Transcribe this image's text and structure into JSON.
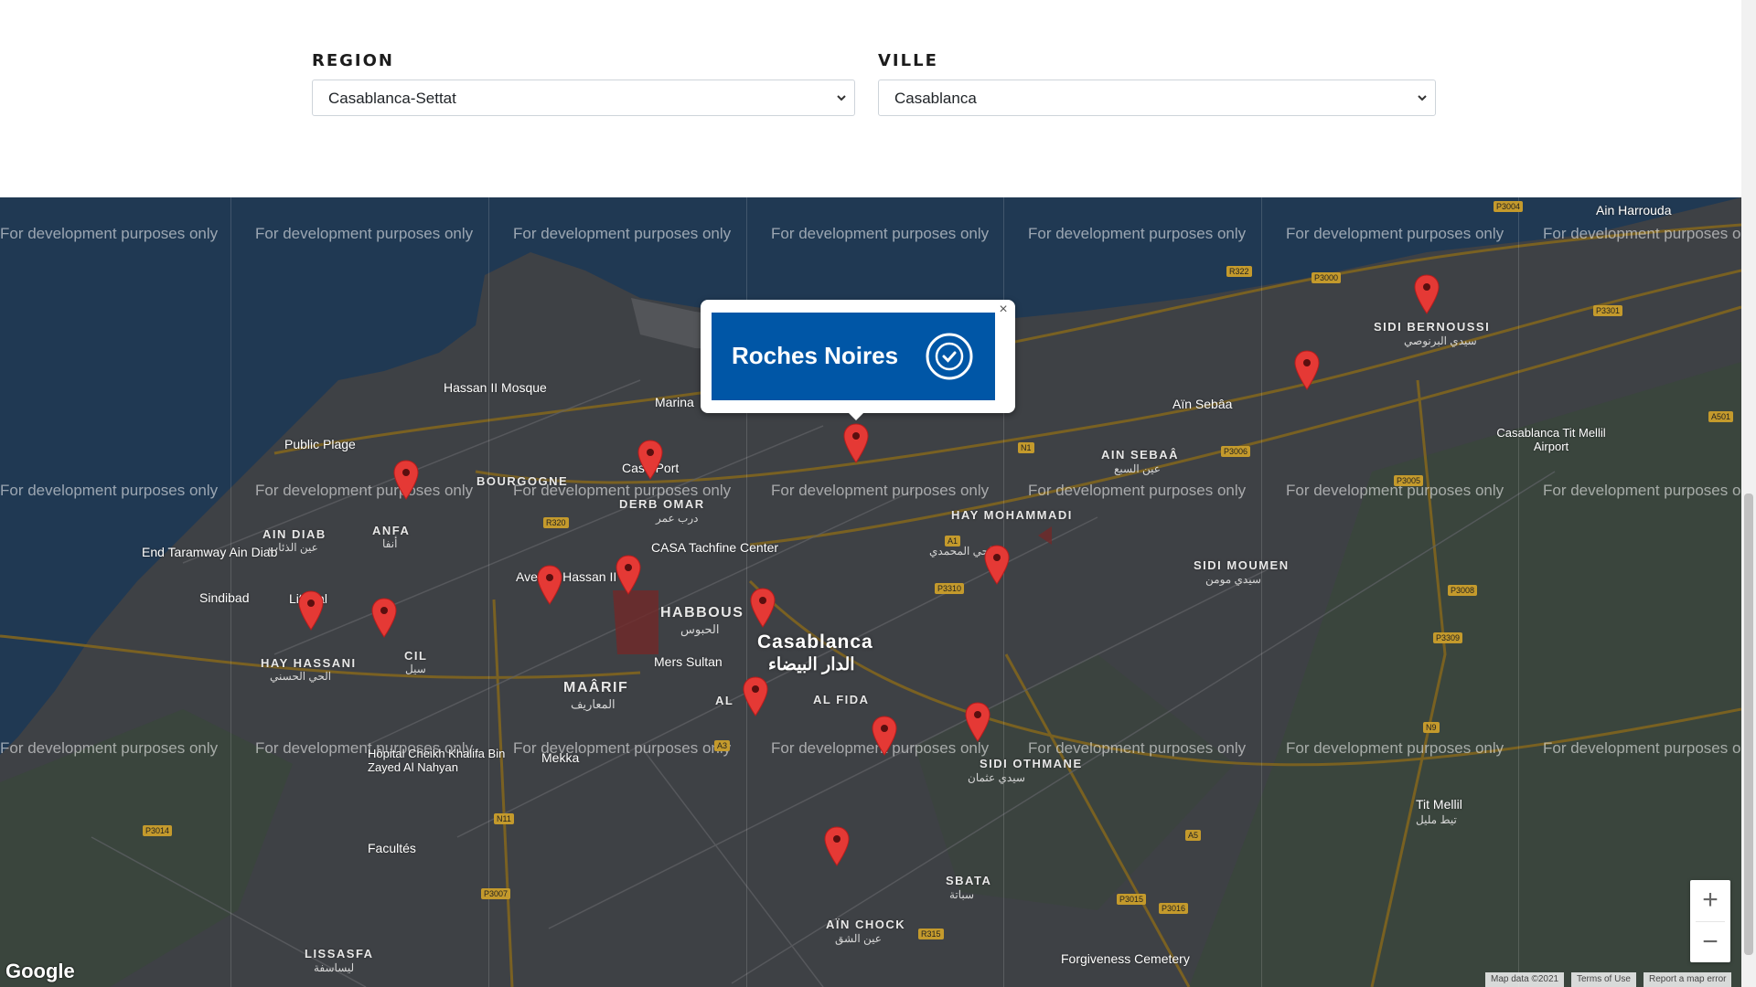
{
  "filters": {
    "region": {
      "label": "REGION",
      "value": "Casablanca-Settat"
    },
    "ville": {
      "label": "VILLE",
      "value": "Casablanca"
    }
  },
  "map": {
    "watermark": "For development purposes only",
    "popup": {
      "title": "Roches Noires",
      "close": "×"
    },
    "zoom_in": "+",
    "zoom_out": "−",
    "logo": "Google",
    "attribution": {
      "map_data": "Map data ©2021",
      "terms": "Terms of Use",
      "report": "Report a map error"
    },
    "places": {
      "hassan_mosque": "Hassan II Mosque",
      "public_plage": "Public Plage",
      "marina": "Marina",
      "casa_port": "Casa Port",
      "end_taramway": "End Taramway Ain Diab",
      "sindibad": "Sindibad",
      "littoral": "Littoral",
      "casa_tachfine": "CASA Tachfine Center",
      "casablanca": "Casablanca",
      "casablanca_ar": "الدار البيضاء",
      "mers_sultan": "Mers Sultan",
      "mekka": "Mekka",
      "facultes": "Facultés",
      "hopital": "Hôpital Cheikh Khalifa Bin Zayed Al Nahyan",
      "forgiveness": "Forgiveness Cemetery",
      "airport": "Casablanca Tit Mellil Airport",
      "tit_mellil": "Tit Mellil",
      "tit_mellil_ar": "تيط مليل",
      "ain_harrouda": "Ain Harrouda",
      "ain_sebaa_top": "Aïn Sebâa",
      "avenue_hassan": "Avenue Hassan II"
    },
    "districts": {
      "bourgogne": "BOURGOGNE",
      "derb_omar": "DERB OMAR",
      "derb_omar_ar": "درب عمر",
      "anfa": "ANFA",
      "anfa_ar": "أنفا",
      "ain_diab": "AIN DIAB",
      "ain_diab_ar": "عين الذئاب",
      "habbous": "HABBOUS",
      "habbous_ar": "الحبوس",
      "maarif": "MAÂRIF",
      "maarif_ar": "المعاريف",
      "hay_hassani": "HAY HASSANI",
      "hay_hassani_ar": "الحي الحسني",
      "cil": "CIL",
      "cil_ar": "سيل",
      "hay_mohammadi": "HAY MOHAMMADI",
      "hay_mohammadi_ar": "الحي المحمدي",
      "ain_sebaa": "AIN SEBAÂ",
      "ain_sebaa_ar": "عين السبع",
      "sidi_bernoussi": "SIDI BERNOUSSI",
      "sidi_bernoussi_ar": "سيدي البرنوصي",
      "sidi_moumen": "SIDI MOUMEN",
      "sidi_moumen_ar": "سيدي مومن",
      "al_fida": "AL FIDA",
      "sidi_othmane": "SIDI OTHMANE",
      "sidi_othmane_ar": "سيدي عثمان",
      "sbata": "SBATA",
      "sbata_ar": "سباتة",
      "ain_chock": "AÏN CHOCK",
      "ain_chock_ar": "عين الشق",
      "lissasfa": "LISSASFA",
      "lissasfa_ar": "ليساسفة",
      "al": "AL"
    },
    "roads": [
      "R322",
      "P3000",
      "P3004",
      "P3301",
      "N1",
      "R320",
      "P3006",
      "P3005",
      "A501",
      "N9",
      "P3310",
      "P3014",
      "P3007",
      "N11",
      "A3",
      "A5",
      "A1",
      "P3015",
      "P3016",
      "P3309",
      "R315",
      "P3008"
    ]
  },
  "colors": {
    "accent": "#0056a6",
    "marker": "#e53935",
    "sea": "#2b4a6b",
    "land": "#4a4c52",
    "park": "#3f6b46"
  }
}
